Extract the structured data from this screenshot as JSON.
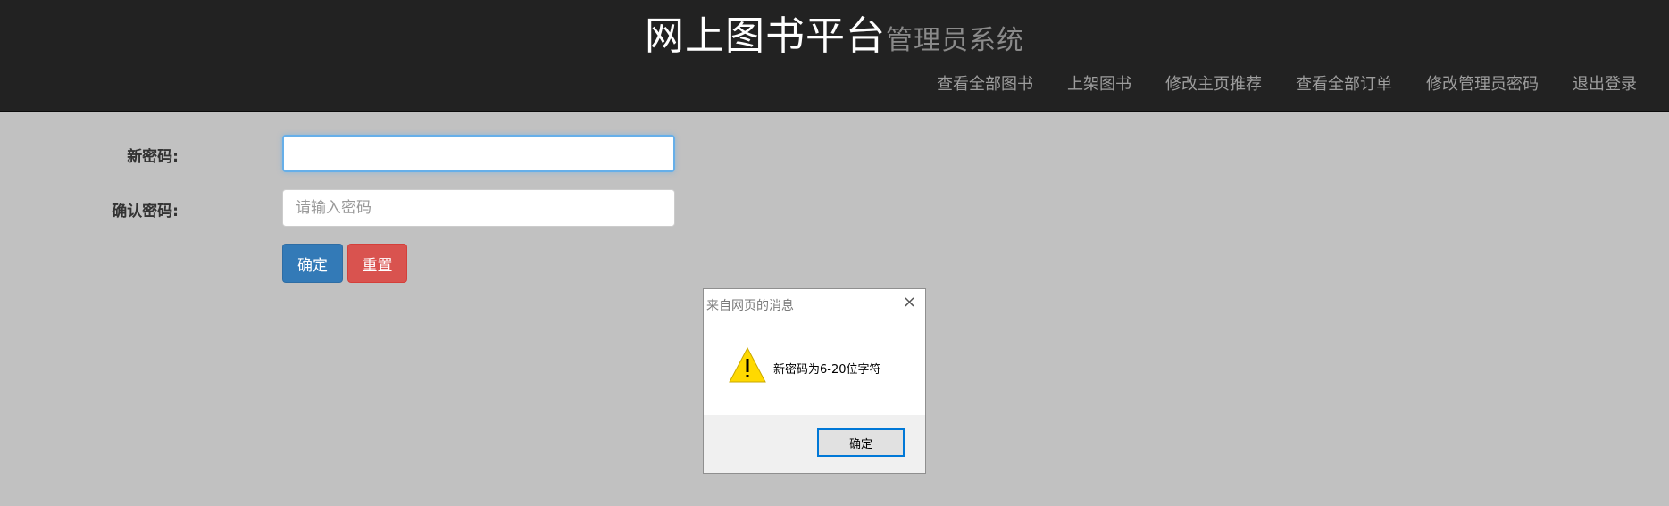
{
  "header": {
    "title": "网上图书平台",
    "subtitle": "管理员系统",
    "nav": [
      {
        "label": "查看全部图书"
      },
      {
        "label": "上架图书"
      },
      {
        "label": "修改主页推荐"
      },
      {
        "label": "查看全部订单"
      },
      {
        "label": "修改管理员密码"
      },
      {
        "label": "退出登录"
      }
    ]
  },
  "form": {
    "new_password": {
      "label": "新密码:",
      "value": "",
      "placeholder": ""
    },
    "confirm_password": {
      "label": "确认密码:",
      "value": "",
      "placeholder": "请输入密码"
    },
    "confirm_button": "确定",
    "reset_button": "重置"
  },
  "dialog": {
    "title": "来自网页的消息",
    "close_icon": "×",
    "icon": "warning-icon",
    "message": "新密码为6-20位字符",
    "ok_button": "确定"
  },
  "colors": {
    "header_bg": "#222222",
    "page_bg": "#c1c1c1",
    "primary": "#337ab7",
    "danger": "#d9534f",
    "warning": "#ffd900"
  }
}
